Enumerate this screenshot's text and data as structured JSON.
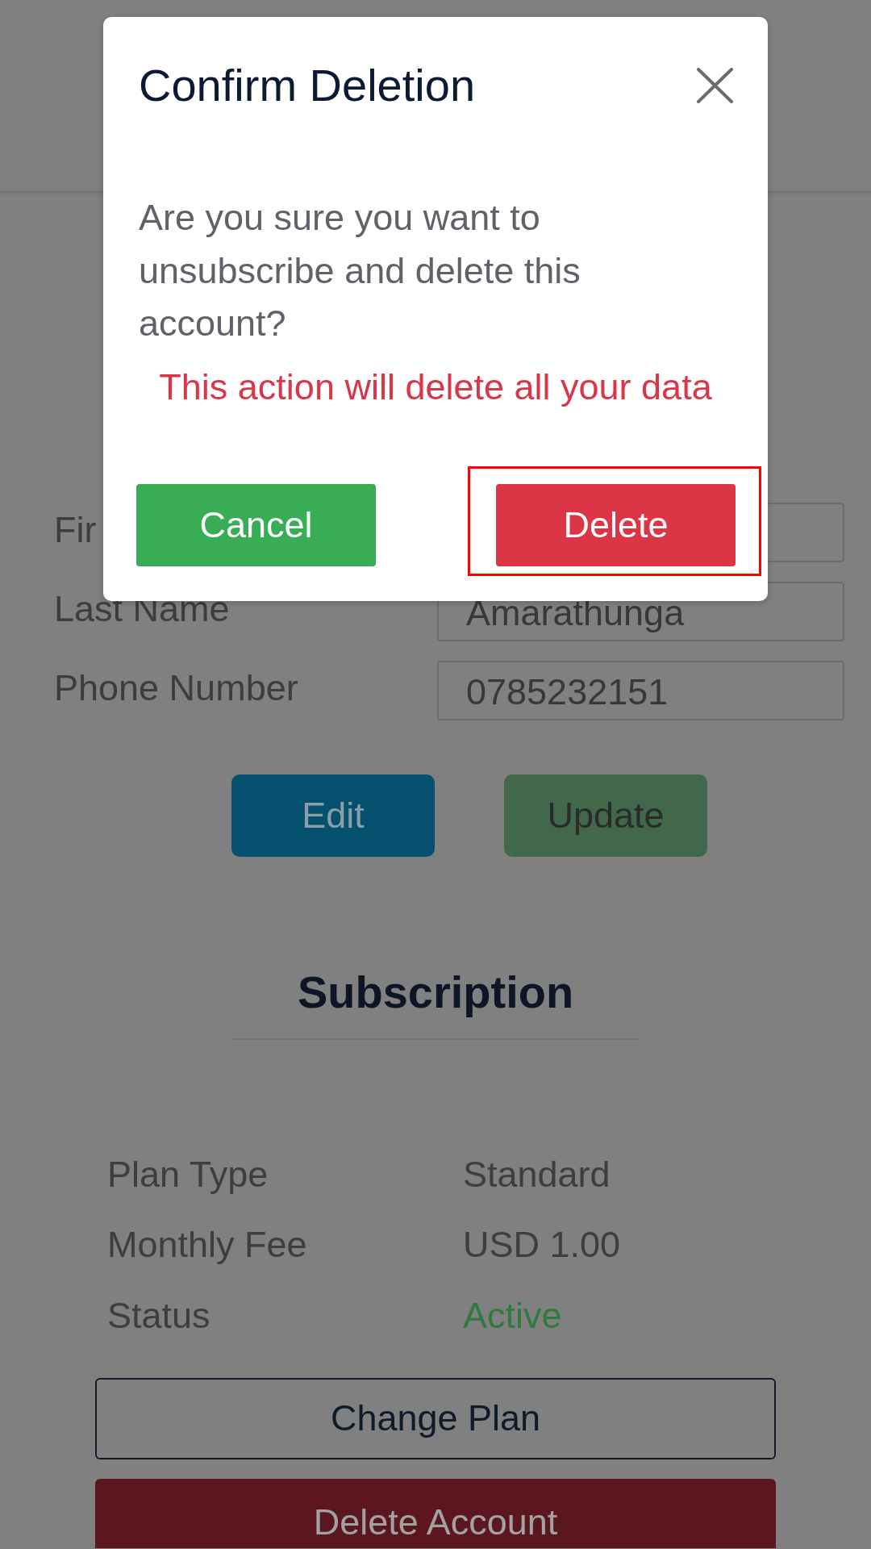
{
  "form": {
    "fields": [
      {
        "label": "Fir"
      },
      {
        "label": "Last Name",
        "value": "Amarathunga"
      },
      {
        "label": "Phone Number",
        "value": "0785232151"
      }
    ],
    "buttons": [
      {
        "label": "Edit",
        "kind": "edit"
      },
      {
        "label": "Update",
        "kind": "update"
      }
    ]
  },
  "subscription": {
    "title": "Subscription",
    "rows": [
      {
        "label": "Plan Type",
        "value": "Standard",
        "kind": "plain"
      },
      {
        "label": "Monthly Fee",
        "value": "USD 1.00",
        "kind": "plain"
      },
      {
        "label": "Status",
        "value": "Active",
        "kind": "status"
      }
    ],
    "buttons": [
      {
        "label": "Change Plan",
        "kind": "outline"
      },
      {
        "label": "Delete Account",
        "kind": "danger"
      }
    ]
  },
  "modal": {
    "title": "Confirm Deletion",
    "message": "Are you sure you want to unsubscribe and delete this account?",
    "warning": "This action will delete all your data",
    "buttons": [
      {
        "label": "Cancel",
        "kind": "success",
        "highlighted": false
      },
      {
        "label": "Delete",
        "kind": "danger",
        "highlighted": true
      }
    ]
  }
}
